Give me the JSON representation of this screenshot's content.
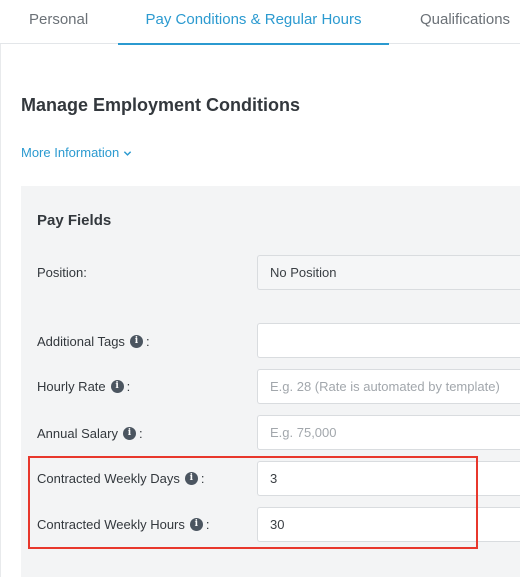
{
  "tabs": [
    {
      "label": "Personal"
    },
    {
      "label": "Pay Conditions & Regular Hours"
    },
    {
      "label": "Qualifications"
    }
  ],
  "header": {
    "title": "Manage Employment Conditions",
    "more_info": "More Information"
  },
  "pay_fields": {
    "title": "Pay Fields",
    "position": {
      "label": "Position:",
      "value": "No Position"
    },
    "additional_tags": {
      "label": "Additional Tags",
      "suffix": ":",
      "value": ""
    },
    "hourly_rate": {
      "label": "Hourly Rate",
      "suffix": ":",
      "placeholder": "E.g. 28 (Rate is automated by template)"
    },
    "annual_salary": {
      "label": "Annual Salary",
      "suffix": ":",
      "placeholder": "E.g. 75,000"
    },
    "weekly_days": {
      "label": "Contracted Weekly Days",
      "suffix": ":",
      "value": "3"
    },
    "weekly_hours": {
      "label": "Contracted Weekly Hours",
      "suffix": ":",
      "value": "30"
    }
  },
  "icons": {
    "info": "info-icon",
    "chevron": "chevron-down-icon"
  },
  "colors": {
    "accent": "#2b9ad0",
    "highlight": "#e8372c",
    "panel": "#f3f4f5"
  }
}
